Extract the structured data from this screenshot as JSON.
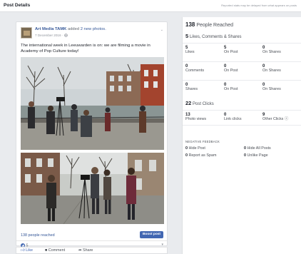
{
  "header": {
    "title": "Post Details",
    "note": "Reported stats may be delayed from what appears on posts"
  },
  "post": {
    "author": "Art Media TAMK",
    "verb": "added",
    "object_link": "2 new photos.",
    "date": "7 December 2016 ·",
    "text": "The international week in Leeuwarden is on: we are filming a movie in Academy of Pop Culture today!",
    "people_reached": "138 people reached",
    "boost_label": "Boost post",
    "reactions_count": "5",
    "actions": [
      "Like",
      "Comment",
      "Share"
    ]
  },
  "stats": {
    "reach_count": "138",
    "reach_label": "People Reached",
    "engagement_count": "5",
    "engagement_label": "Likes, Comments & Shares",
    "rows": [
      [
        {
          "num": "5",
          "label": "Likes"
        },
        {
          "num": "5",
          "label": "On Post"
        },
        {
          "num": "0",
          "label": "On Shares"
        }
      ],
      [
        {
          "num": "0",
          "label": "Comments"
        },
        {
          "num": "0",
          "label": "On Post"
        },
        {
          "num": "0",
          "label": "On Shares"
        }
      ],
      [
        {
          "num": "0",
          "label": "Shares"
        },
        {
          "num": "0",
          "label": "On Post"
        },
        {
          "num": "0",
          "label": "On Shares"
        }
      ]
    ],
    "clicks_count": "22",
    "clicks_label": "Post Clicks",
    "click_row": [
      {
        "num": "13",
        "label": "Photo views"
      },
      {
        "num": "0",
        "label": "Link clicks"
      },
      {
        "num": "9",
        "label": "Other Clicks ⓘ"
      }
    ],
    "negative_header": "NEGATIVE FEEDBACK",
    "negative": [
      {
        "num": "0",
        "label": "Hide Post"
      },
      {
        "num": "0",
        "label": "Hide All Posts"
      },
      {
        "num": "0",
        "label": "Report as Spam"
      },
      {
        "num": "0",
        "label": "Unlike Page"
      }
    ]
  },
  "colors": {
    "link": "#365899",
    "boost": "#4267b2",
    "background": "#e9ebee"
  }
}
